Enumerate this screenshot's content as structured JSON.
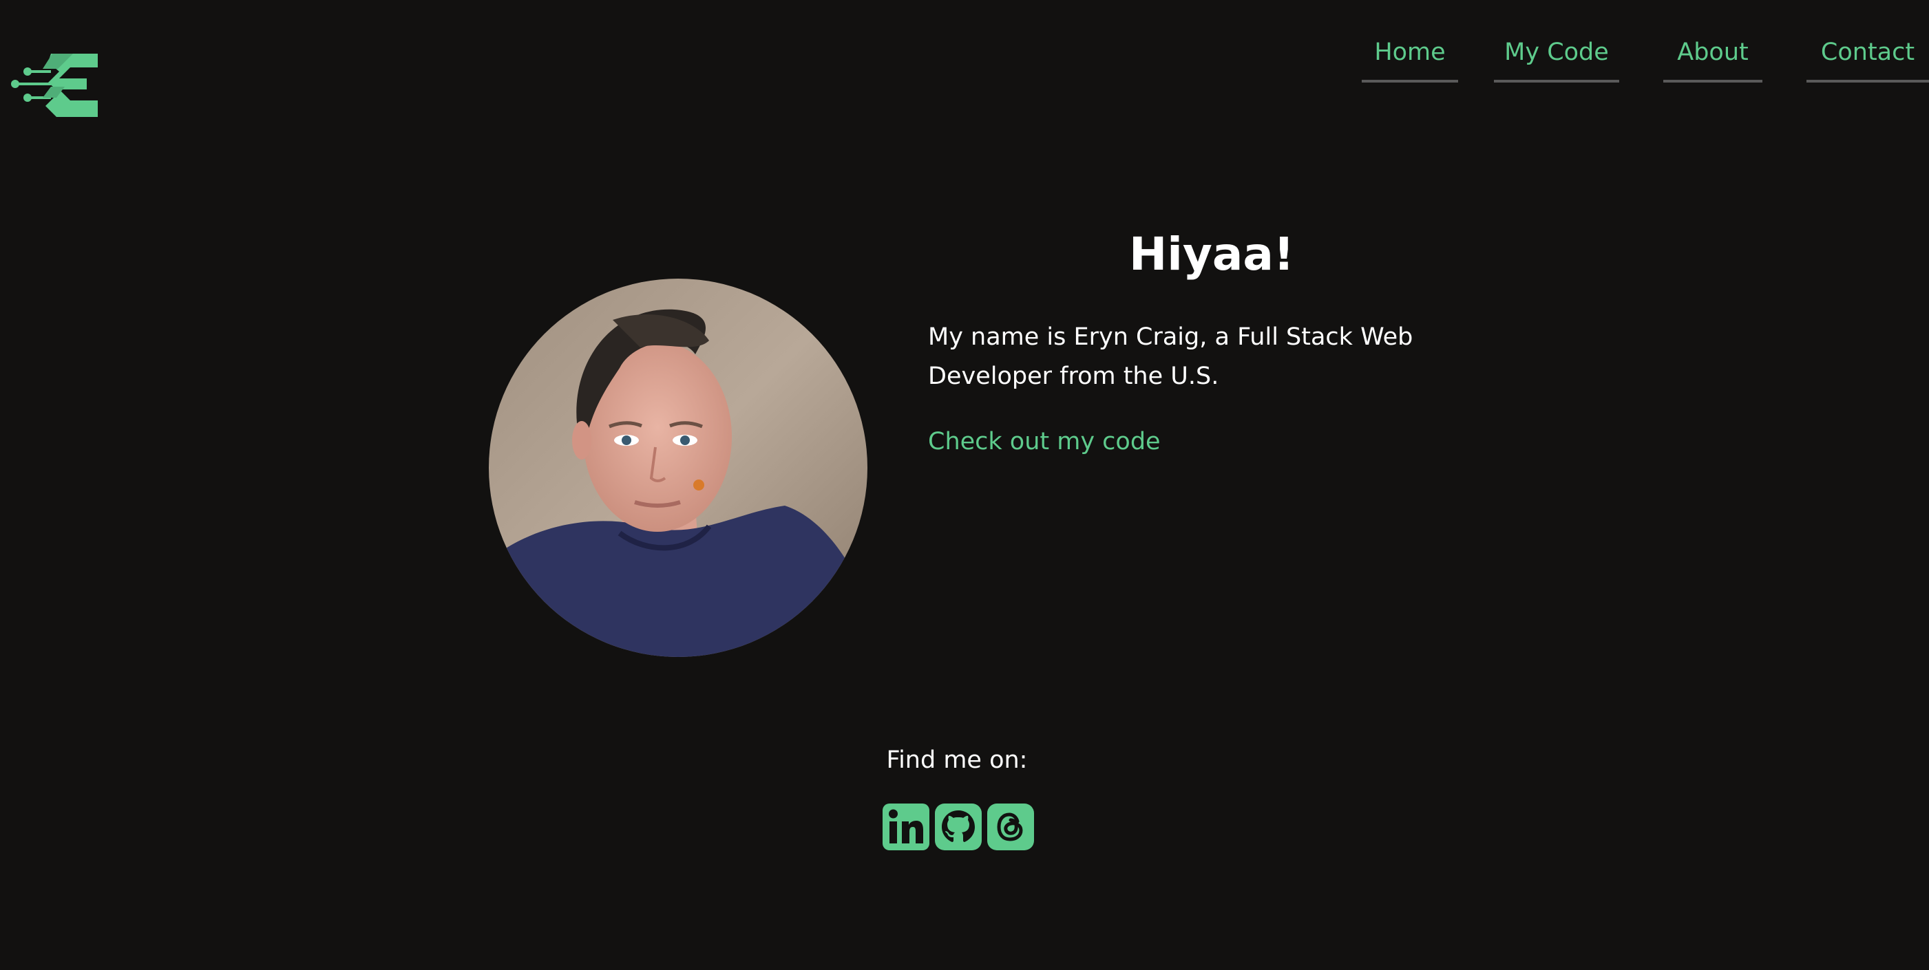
{
  "logo": {
    "icon": "circuit-e-logo-icon",
    "color": "#5ecb8c"
  },
  "nav": {
    "items": [
      {
        "label": "Home"
      },
      {
        "label": "My Code"
      },
      {
        "label": "About"
      },
      {
        "label": "Contact"
      }
    ],
    "accent_color": "#5ecb8c"
  },
  "hero": {
    "title": "Hiyaa!",
    "description": "My name is Eryn Craig, a Full Stack Web Developer from the U.S.",
    "link_label": "Check out my code",
    "avatar_icon": "profile-photo"
  },
  "socials": {
    "label": "Find me on:",
    "items": [
      {
        "icon": "linkedin-icon"
      },
      {
        "icon": "github-icon"
      },
      {
        "icon": "threads-icon"
      }
    ]
  },
  "theme": {
    "background": "#121110",
    "accent": "#5ecb8c",
    "text": "#ffffff"
  }
}
